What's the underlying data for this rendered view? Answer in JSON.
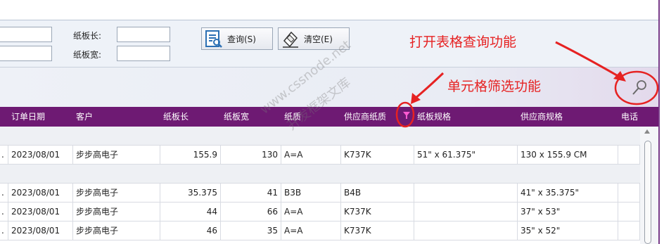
{
  "search": {
    "board_length_label": "纸板长:",
    "board_width_label": "纸板宽:",
    "board_length_value": "",
    "board_width_value": "",
    "query_button": "查询(S)",
    "clear_button": "清空(E)"
  },
  "annotations": {
    "open_table_query": "打开表格查询功能",
    "cell_filter": "单元格筛选功能"
  },
  "watermark": {
    "line1": "www.cssnode.net",
    "line2": "开发框架文库"
  },
  "colors": {
    "header_bg": "#6e1a73",
    "annotation": "#e62222"
  },
  "table": {
    "columns": [
      "订单日期",
      "客户",
      "纸板长",
      "纸板宽",
      "纸质",
      "供应商纸质",
      "纸板规格",
      "供应商规格",
      "电话"
    ],
    "rows": [
      {
        "group": true
      },
      {
        "prefix": ".",
        "date": "2023/08/01",
        "customer": "步步高电子",
        "length": "155.9",
        "width": "130",
        "paper": "A=A",
        "supplier_paper": "K737K",
        "board_spec": "51\" x 61.375\"",
        "supplier_spec": "130 x 155.9 CM",
        "phone": ""
      },
      {
        "group": true
      },
      {
        "prefix": ".",
        "date": "2023/08/01",
        "customer": "步步高电子",
        "length": "35.375",
        "width": "41",
        "paper": "B3B",
        "supplier_paper": "B4B",
        "board_spec": "",
        "supplier_spec": "41\" x 35.375\"",
        "phone": ""
      },
      {
        "prefix": ".",
        "date": "2023/08/01",
        "customer": "步步高电子",
        "length": "44",
        "width": "66",
        "paper": "A=A",
        "supplier_paper": "K737K",
        "board_spec": "",
        "supplier_spec": "37\" x 53\"",
        "phone": ""
      },
      {
        "prefix": ".",
        "date": "2023/08/01",
        "customer": "步步高电子",
        "length": "46",
        "width": "35",
        "paper": "A=A",
        "supplier_paper": "K737K",
        "board_spec": "",
        "supplier_spec": "35\" x 52\"",
        "phone": ""
      }
    ]
  }
}
